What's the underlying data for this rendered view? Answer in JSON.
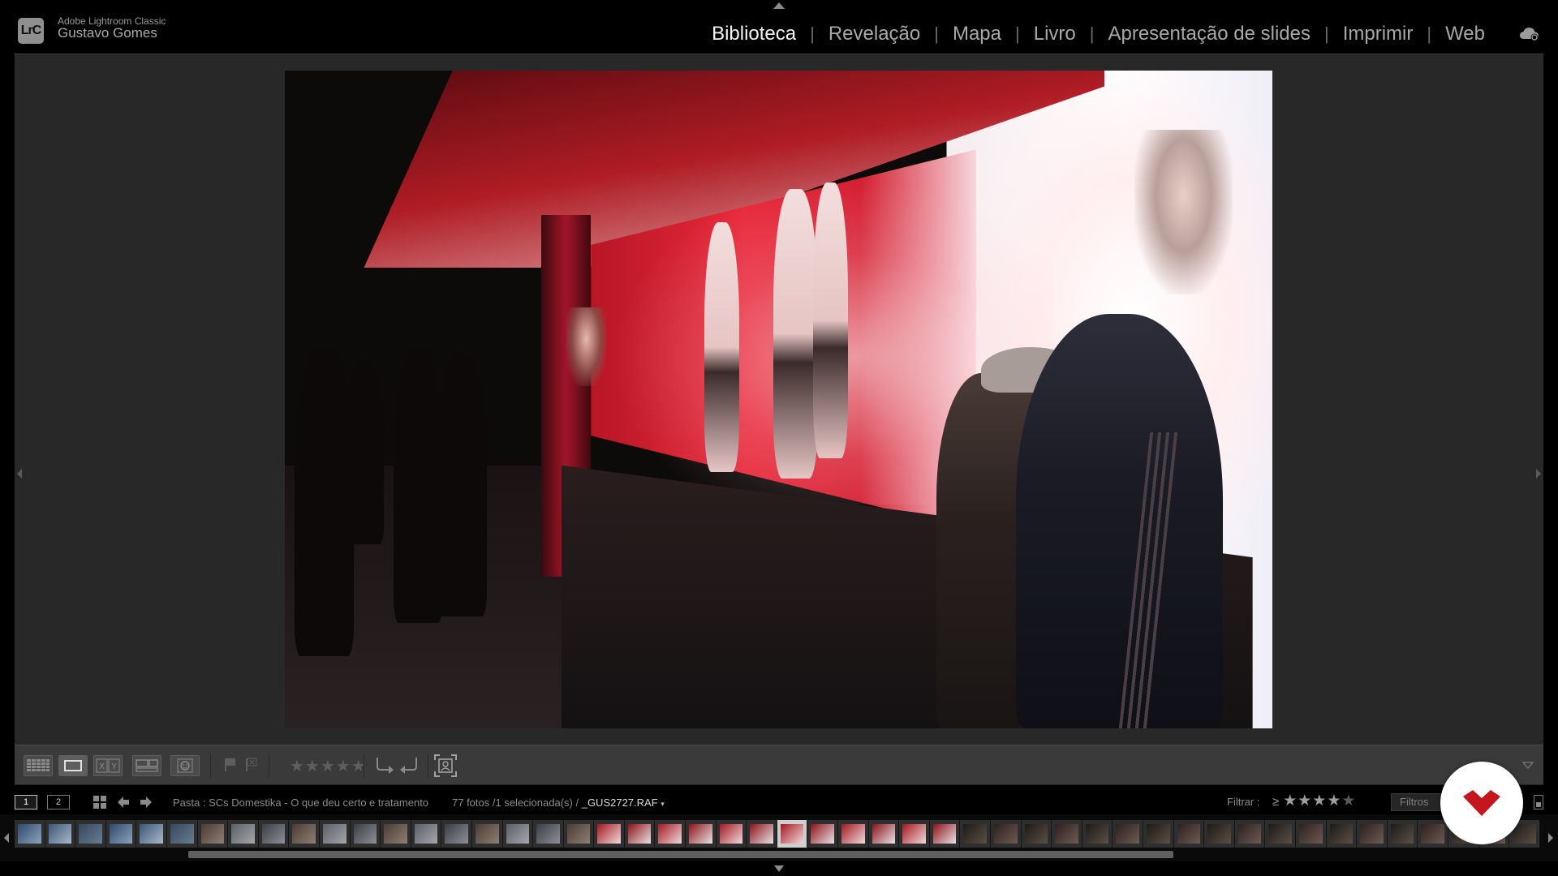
{
  "app": {
    "logo_text": "LrC",
    "product_name": "Adobe Lightroom Classic",
    "user_name": "Gustavo Gomes"
  },
  "modules": [
    {
      "label": "Biblioteca",
      "active": true
    },
    {
      "label": "Revelação",
      "active": false
    },
    {
      "label": "Mapa",
      "active": false
    },
    {
      "label": "Livro",
      "active": false
    },
    {
      "label": "Apresentação de slides",
      "active": false
    },
    {
      "label": "Imprimir",
      "active": false
    },
    {
      "label": "Web",
      "active": false
    }
  ],
  "toolbar": {
    "view_modes": [
      "grid-view-icon",
      "loupe-view-icon",
      "compare-view-icon",
      "survey-view-icon",
      "people-view-icon"
    ],
    "compare_label": "X|Y",
    "rating_stars": "★★★★★"
  },
  "filmstrip_header": {
    "screen1_label": "1",
    "screen2_label": "2",
    "path_text": "Pasta : SCs Domestika - O que deu certo e tratamento",
    "count_text": "77 fotos /1 selecionada(s) /",
    "filename": "_GUS2727.RAF",
    "filter_label": "Filtrar :",
    "filter_operator": "≥",
    "filter_stars_on": "★★★★",
    "filter_stars_off": "★",
    "filter_select": "Filtros desativados"
  },
  "filmstrip": {
    "thumbnail_count": 50,
    "selected_index": 25
  },
  "colors": {
    "accent_red": "#c4161c",
    "active_module": "#f2f2f2",
    "inactive_module": "#a8a8a8"
  },
  "badge": {
    "brand": "domestika-logo"
  }
}
